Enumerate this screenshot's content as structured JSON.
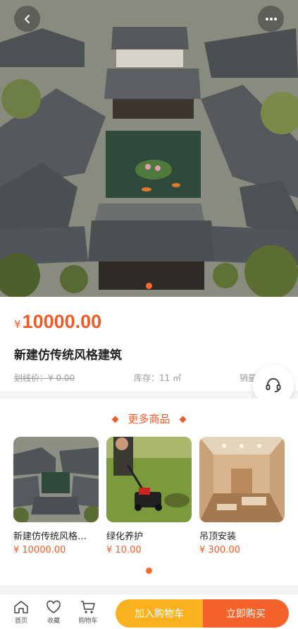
{
  "product": {
    "currency": "¥",
    "price": "10000.00",
    "title": "新建仿传统风格建筑",
    "original_price": "划线价：¥ 0.00",
    "stock": "库存：11 ㎡",
    "sales": "销量"
  },
  "more_section": {
    "title": "更多商品",
    "items": [
      {
        "name": "新建仿传统风格…",
        "price": "¥ 10000.00",
        "icon": "courtyard-photo"
      },
      {
        "name": "绿化养护",
        "price": "¥ 10.00",
        "icon": "lawn-mowing-photo"
      },
      {
        "name": "吊顶安装",
        "price": "¥ 300.00",
        "icon": "ceiling-room-photo"
      }
    ]
  },
  "bottom_bar": {
    "home_label": "首页",
    "favorite_label": "收藏",
    "cart_label": "购物车",
    "add_to_cart": "加入购物车",
    "buy_now": "立即购买"
  },
  "colors": {
    "accent": "#f05a28",
    "cart_button": "#f9b120",
    "buy_button": "#f4622b"
  }
}
